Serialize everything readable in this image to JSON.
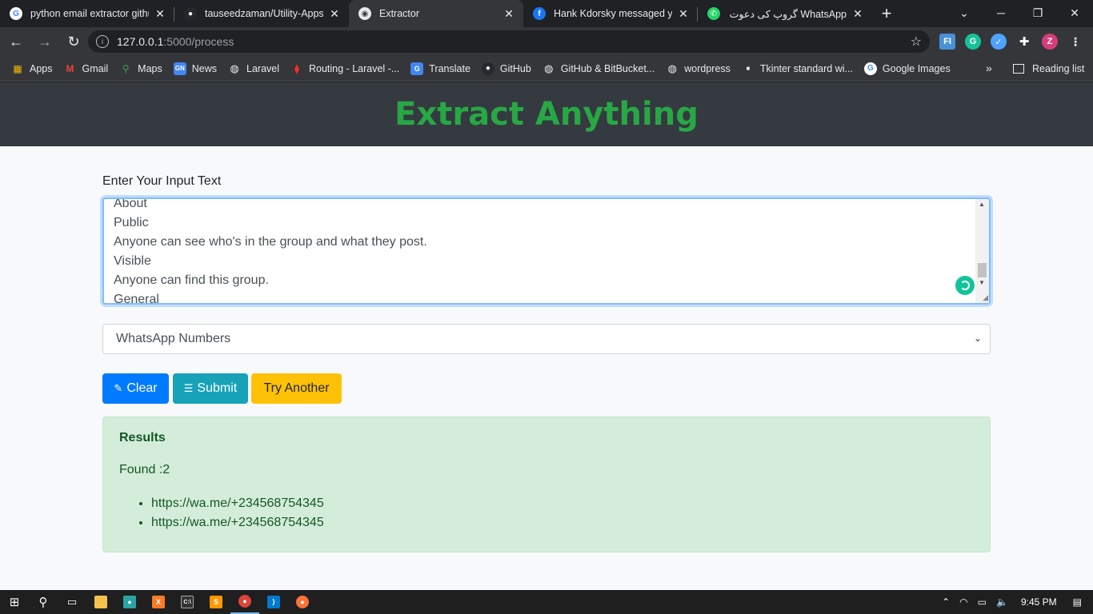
{
  "tabs": [
    {
      "title": "python email extractor github",
      "icon": "google-icon",
      "active": false
    },
    {
      "title": "tauseedzaman/Utility-Apps a",
      "icon": "github-icon",
      "active": false
    },
    {
      "title": "Extractor",
      "icon": "globe-icon",
      "active": true
    },
    {
      "title": "Hank Kdorsky messaged you",
      "icon": "facebook-icon",
      "active": false
    },
    {
      "title": "گروپ کی دعوت WhatsApp",
      "icon": "whatsapp-icon",
      "active": false
    }
  ],
  "address": {
    "host": "127.0.0.1",
    "path": ":5000/process"
  },
  "bookmarks": [
    {
      "label": "Apps",
      "icon": "apps-grid-icon"
    },
    {
      "label": "Gmail",
      "icon": "gmail-icon"
    },
    {
      "label": "Maps",
      "icon": "maps-icon"
    },
    {
      "label": "News",
      "icon": "news-icon"
    },
    {
      "label": "Laravel",
      "icon": "globe-icon"
    },
    {
      "label": "Routing - Laravel -...",
      "icon": "laravel-icon"
    },
    {
      "label": "Translate",
      "icon": "translate-icon"
    },
    {
      "label": "GitHub",
      "icon": "github-icon"
    },
    {
      "label": "GitHub & BitBucket...",
      "icon": "globe-icon"
    },
    {
      "label": "wordpress",
      "icon": "globe-icon"
    },
    {
      "label": "Tkinter standard wi...",
      "icon": "page-icon"
    },
    {
      "label": "Google Images",
      "icon": "google-icon"
    }
  ],
  "reading_list": "Reading list",
  "page": {
    "heading": "Extract Anything",
    "input_label": "Enter Your Input Text",
    "textarea_lines": [
      "About",
      "Public",
      "Anyone can see who's in the group and what they post.",
      "Visible",
      "Anyone can find this group.",
      "General"
    ],
    "select_value": "WhatsApp Numbers",
    "buttons": {
      "clear": "Clear",
      "submit": "Submit",
      "try_another": "Try Another"
    },
    "results": {
      "title": "Results",
      "found": "Found :2",
      "items": [
        "https://wa.me/+234568754345",
        "https://wa.me/+234568754345"
      ]
    }
  },
  "taskbar": {
    "time": "9:45 PM"
  },
  "colors": {
    "accent_green": "#28a745",
    "primary": "#007bff",
    "info": "#17a2b8",
    "warning": "#ffc107",
    "hero_bg": "#343a40"
  }
}
